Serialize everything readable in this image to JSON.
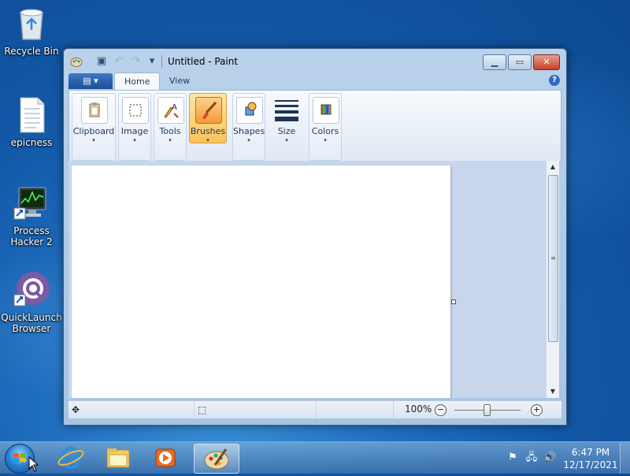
{
  "desktop": {
    "icons": [
      {
        "label": "Recycle Bin",
        "icon": "recycle-bin-icon"
      },
      {
        "label": "epicness",
        "icon": "text-file-icon"
      },
      {
        "label": "Process Hacker 2",
        "icon": "process-hacker-icon"
      },
      {
        "label": "QuickLaunch Browser",
        "icon": "quicklaunch-browser-icon"
      }
    ]
  },
  "window": {
    "title": "Untitled - Paint",
    "controls": {
      "minimize": "▁",
      "maximize": "▭",
      "close": "✕"
    },
    "qat": {
      "save": "▣",
      "undo": "↶",
      "redo": "↷",
      "customize": "▾"
    }
  },
  "ribbon": {
    "app_menu": "▤ ▾",
    "tabs": [
      {
        "label": "Home",
        "active": true
      },
      {
        "label": "View",
        "active": false
      }
    ],
    "help": "?",
    "groups": [
      {
        "label": "Clipboard",
        "glyph": "📋",
        "selected": false
      },
      {
        "label": "Image",
        "glyph": "⬚",
        "selected": false
      },
      {
        "label": "Tools",
        "glyph": "✎",
        "selected": false
      },
      {
        "label": "Brushes",
        "glyph": "🖌",
        "selected": true
      },
      {
        "label": "Shapes",
        "glyph": "◆",
        "selected": false
      },
      {
        "label": "Size",
        "glyph": "≡",
        "selected": false
      },
      {
        "label": "Colors",
        "glyph": "▦",
        "selected": false
      }
    ],
    "dropdown_arrow": "▾"
  },
  "statusbar": {
    "move_icon": "✥",
    "selection_icon": "⬚",
    "zoom": "100%",
    "zoom_out": "−",
    "zoom_in": "+"
  },
  "scrollbar": {
    "up": "▲",
    "down": "▼",
    "grip": "≡"
  },
  "taskbar": {
    "pinned": [
      {
        "name": "Internet Explorer",
        "icon": "internet-explorer-icon"
      },
      {
        "name": "Windows Explorer",
        "icon": "file-explorer-icon"
      },
      {
        "name": "Windows Media Player",
        "icon": "media-player-icon"
      },
      {
        "name": "Paint",
        "icon": "paint-icon",
        "active": true
      }
    ],
    "tray": {
      "action_center": "⚑",
      "network": "🖧",
      "volume": "🔊"
    },
    "clock": {
      "time": "6:47 PM",
      "date": "12/17/2021"
    }
  },
  "colors": {
    "accent": "#2e6bc7",
    "selected_group": "#f9c25c",
    "close_button": "#c7402a"
  }
}
